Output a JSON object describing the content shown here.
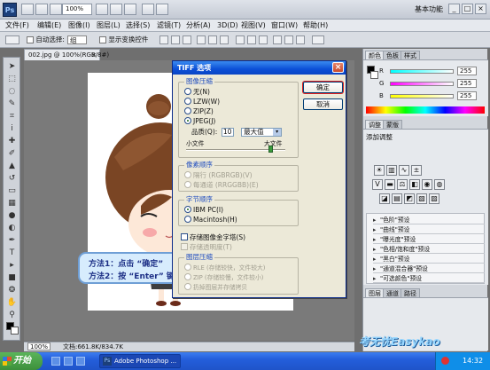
{
  "app": {
    "logo": "Ps",
    "zoom": "100%",
    "workspace": "基本功能",
    "window_controls": [
      "_",
      "□",
      "×"
    ]
  },
  "menu": [
    "文件(F)",
    "编辑(E)",
    "图像(I)",
    "图层(L)",
    "选择(S)",
    "滤镜(T)",
    "分析(A)",
    "3D(D)",
    "视图(V)",
    "窗口(W)",
    "帮助(H)"
  ],
  "options_bar": {
    "auto_select_label": "自动选择:",
    "auto_select_value": "组",
    "show_transform_label": "显示变换控件"
  },
  "document": {
    "tab_title": "002.jpg @ 100%(RGB/8#)",
    "tab_close": "×",
    "status_zoom": "100%",
    "status_doc": "文档:661.8K/834.7K"
  },
  "callout": {
    "line1": "方法1：点击 “确定”",
    "line2": "方法2：按 “Enter” 键"
  },
  "dialog": {
    "title": "TIFF 选项",
    "close": "×",
    "ok": "确定",
    "cancel": "取消",
    "compression": {
      "title": "图像压缩",
      "options": [
        "无(N)",
        "LZW(W)",
        "ZIP(Z)",
        "JPEG(J)"
      ],
      "selected": "JPEG(J)",
      "quality_label": "品质(Q):",
      "quality_value": "10",
      "quality_preset": "最大值",
      "small_file": "小文件",
      "large_file": "大文件",
      "slider_position": 0.86
    },
    "pixel_order": {
      "title": "像素顺序",
      "options": [
        "隔行 (RGBRGB)(V)",
        "每通道 (RRGGBB)(E)"
      ],
      "selected": "隔行 (RGBRGB)(V)",
      "disabled": true
    },
    "byte_order": {
      "title": "字节顺序",
      "options": [
        "IBM PC(I)",
        "Macintosh(H)"
      ],
      "selected": "IBM PC(I)"
    },
    "checkboxes": [
      "存储图像金字塔(S)",
      "存储透明度(T)"
    ],
    "layer_compression": {
      "title": "图层压缩",
      "options": [
        "RLE (存储较快，文件较大)",
        "ZIP (存储较慢，文件较小)",
        "扔掉图层并存储拷贝"
      ]
    }
  },
  "panels": {
    "color_tabs": [
      "颜色",
      "色板",
      "样式"
    ],
    "sliders": [
      {
        "label": "R",
        "value": "255"
      },
      {
        "label": "G",
        "value": "255"
      },
      {
        "label": "B",
        "value": "255"
      }
    ],
    "adjust_tabs": [
      "调整",
      "蒙版"
    ],
    "adjust_title": "添加调整",
    "presets": [
      "\"色阶\"预设",
      "\"曲线\"预设",
      "\"曝光度\"预设",
      "\"色相/饱和度\"预设",
      "\"黑白\"预设",
      "\"通道混合器\"预设",
      "\"可选颜色\"预设"
    ],
    "layer_tabs": [
      "图层",
      "通道",
      "路径"
    ]
  },
  "taskbar": {
    "start": "开始",
    "task": "Adobe Photoshop ...",
    "time": "14:32"
  },
  "watermark": "考无忧Easykao",
  "colors": {
    "dialog_title": "#0b4fd6",
    "callout_border": "#6f9fd6",
    "callout_text": "#1d2f86",
    "taskbar": "#245edb",
    "start_green": "#3c8f3b"
  }
}
